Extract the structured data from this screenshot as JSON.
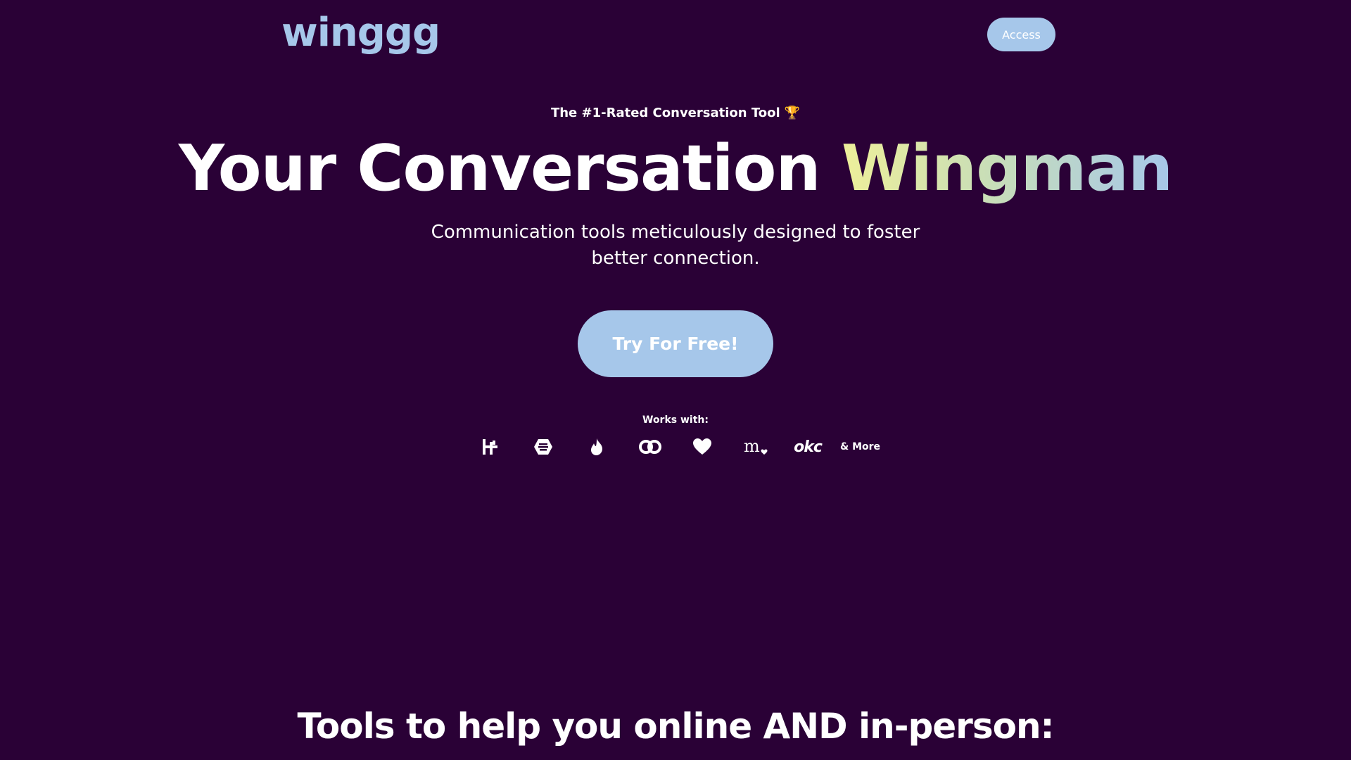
{
  "header": {
    "logo": "winggg",
    "access_label": "Access"
  },
  "hero": {
    "tagline": "The #1-Rated Conversation Tool",
    "tagline_icon": "trophy-icon",
    "headline_main": "Your Conversation ",
    "headline_accent": "Wingman",
    "subtext": "Communication tools meticulously designed to foster better connection.",
    "cta_label": "Try For Free!"
  },
  "works_with": {
    "label": "Works with:",
    "apps": [
      {
        "name": "hinge-icon"
      },
      {
        "name": "bumble-icon"
      },
      {
        "name": "tinder-icon"
      },
      {
        "name": "coffee-meets-bagel-icon"
      },
      {
        "name": "heart-icon"
      },
      {
        "name": "match-icon"
      },
      {
        "name": "okcupid-icon",
        "text": "okc"
      }
    ],
    "more_label": "& More"
  },
  "section": {
    "title": "Tools to help you online AND in-person:"
  },
  "colors": {
    "background": "#2a0136",
    "accent": "#a6c7ea",
    "gradient_start": "#eeef9a",
    "gradient_end": "#a6c7ea"
  }
}
